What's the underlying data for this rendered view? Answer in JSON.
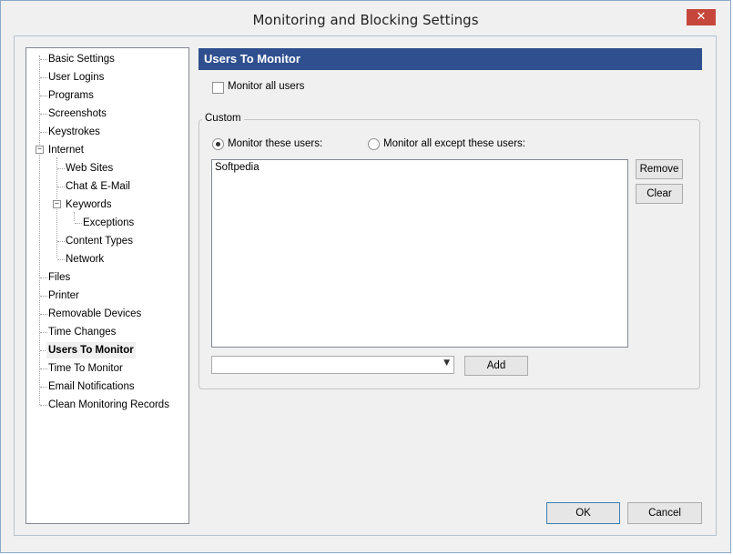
{
  "window": {
    "title": "Monitoring and Blocking Settings",
    "close_glyph": "✕"
  },
  "tree": {
    "items": [
      "Basic Settings",
      "User Logins",
      "Programs",
      "Screenshots",
      "Keystrokes",
      "Internet",
      "Web Sites",
      "Chat & E-Mail",
      "Keywords",
      "Exceptions",
      "Content Types",
      "Network",
      "Files",
      "Printer",
      "Removable Devices",
      "Time Changes",
      "Users To Monitor",
      "Time To Monitor",
      "Email Notifications",
      "Clean Monitoring Records"
    ],
    "expander_glyph": "−"
  },
  "panel": {
    "header": "Users To Monitor",
    "monitor_all_label": "Monitor all users",
    "monitor_all_checked": false,
    "group_title": "Custom",
    "radio_these": "Monitor these users:",
    "radio_except": "Monitor all except these users:",
    "selected_radio": "these",
    "users": [
      "Softpedia"
    ],
    "remove_label": "Remove",
    "clear_label": "Clear",
    "combo_value": "",
    "combo_arrow": "▼",
    "add_label": "Add"
  },
  "footer": {
    "ok_label": "OK",
    "cancel_label": "Cancel"
  }
}
